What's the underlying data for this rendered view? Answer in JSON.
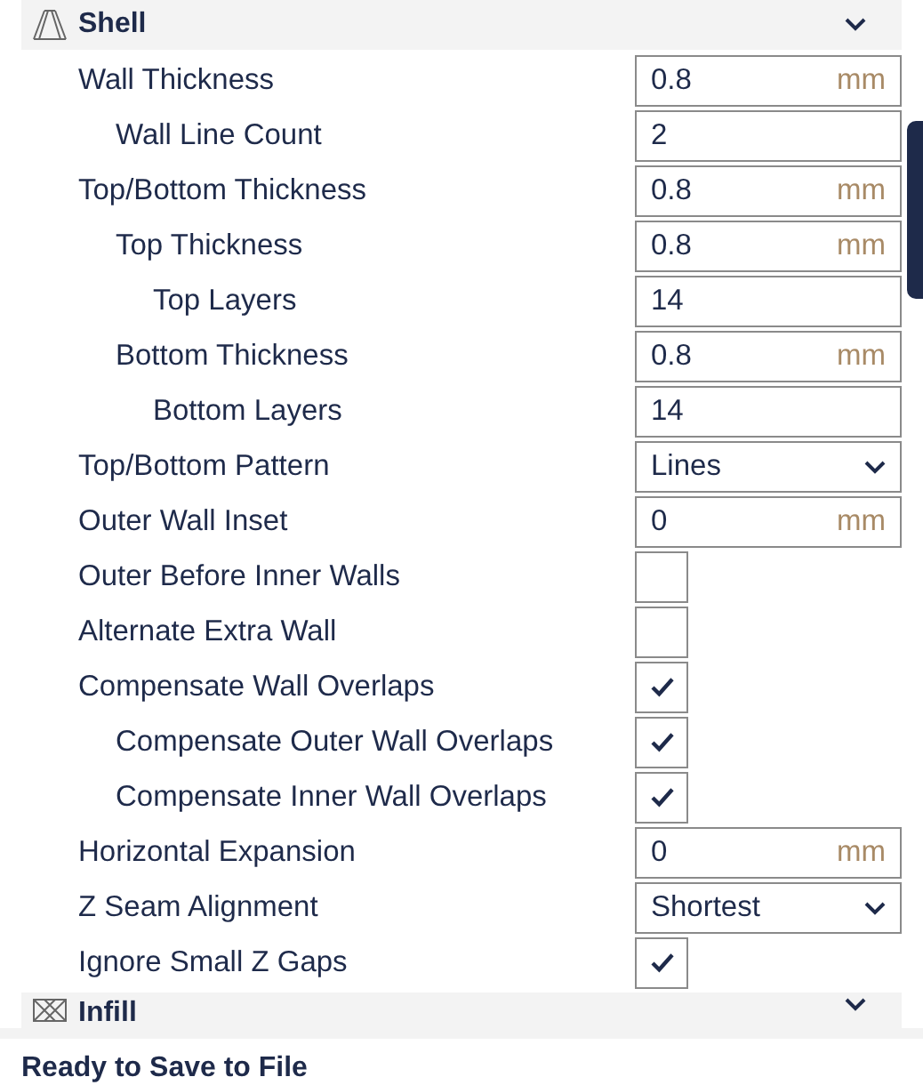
{
  "sections_top": {
    "title": "Shell"
  },
  "settings": [
    {
      "label": "Wall Thickness",
      "kind": "number",
      "value": "0.8",
      "unit": "mm",
      "children": [
        {
          "label": "Wall Line Count",
          "kind": "number",
          "value": "2"
        }
      ]
    },
    {
      "label": "Top/Bottom Thickness",
      "kind": "number",
      "value": "0.8",
      "unit": "mm",
      "children": [
        {
          "label": "Top Thickness",
          "kind": "number",
          "value": "0.8",
          "unit": "mm",
          "children": [
            {
              "label": "Top Layers",
              "kind": "number",
              "value": "14"
            }
          ]
        },
        {
          "label": "Bottom Thickness",
          "kind": "number",
          "value": "0.8",
          "unit": "mm",
          "children": [
            {
              "label": "Bottom Layers",
              "kind": "number",
              "value": "14"
            }
          ]
        }
      ]
    },
    {
      "label": "Top/Bottom Pattern",
      "kind": "select",
      "value": "Lines"
    },
    {
      "label": "Outer Wall Inset",
      "kind": "number",
      "value": "0",
      "unit": "mm"
    },
    {
      "label": "Outer Before Inner Walls",
      "kind": "checkbox",
      "checked": false
    },
    {
      "label": "Alternate Extra Wall",
      "kind": "checkbox",
      "checked": false
    },
    {
      "label": "Compensate Wall Overlaps",
      "kind": "checkbox",
      "checked": true,
      "children": [
        {
          "label": "Compensate Outer Wall Overlaps",
          "kind": "checkbox",
          "checked": true
        },
        {
          "label": "Compensate Inner Wall Overlaps",
          "kind": "checkbox",
          "checked": true
        }
      ]
    },
    {
      "label": "Horizontal Expansion",
      "kind": "number",
      "value": "0",
      "unit": "mm"
    },
    {
      "label": "Z Seam Alignment",
      "kind": "select",
      "value": "Shortest"
    },
    {
      "label": "Ignore Small Z Gaps",
      "kind": "checkbox",
      "checked": true
    }
  ],
  "sections_bottom": {
    "title": "Infill"
  },
  "footer": {
    "title": "Ready to Save to File"
  }
}
